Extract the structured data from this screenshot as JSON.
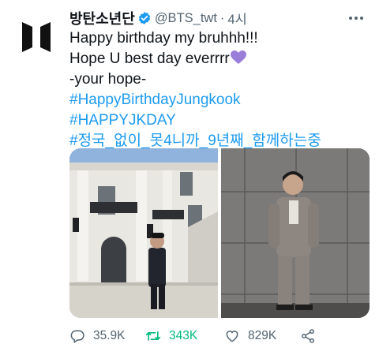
{
  "tweet": {
    "display_name": "방탄소년단",
    "handle": "@BTS_twt",
    "separator": "·",
    "time": "4시",
    "lines": [
      {
        "text": "Happy birthday my bruhhh!!!",
        "type": "text"
      },
      {
        "text": "Hope U best day everrrr",
        "type": "text",
        "emoji": "purple-heart"
      },
      {
        "text": "-your hope-",
        "type": "text"
      },
      {
        "text": "#HappyBirthdayJungkook",
        "type": "hashtag"
      },
      {
        "text": "#HAPPYJKDAY",
        "type": "hashtag"
      },
      {
        "text": "#정국_없이_못4니까_9년째_함께하는중",
        "type": "hashtag"
      }
    ],
    "media": [
      {
        "subject": "man in suit in front of white house"
      },
      {
        "subject": "man in gray suit against gray wall"
      }
    ],
    "stats": {
      "replies": "35.9K",
      "retweets": "343K",
      "likes": "829K"
    }
  },
  "colors": {
    "text": "#0f1419",
    "secondary": "#536471",
    "link": "#1d9bf0",
    "verified": "#1d9bf0",
    "retweet": "#00ba7c",
    "heart": "#9b7ed9"
  },
  "icons": [
    "bts-logo-icon",
    "verified-badge-icon",
    "more-icon",
    "reply-icon",
    "retweet-icon",
    "like-icon",
    "share-icon"
  ]
}
